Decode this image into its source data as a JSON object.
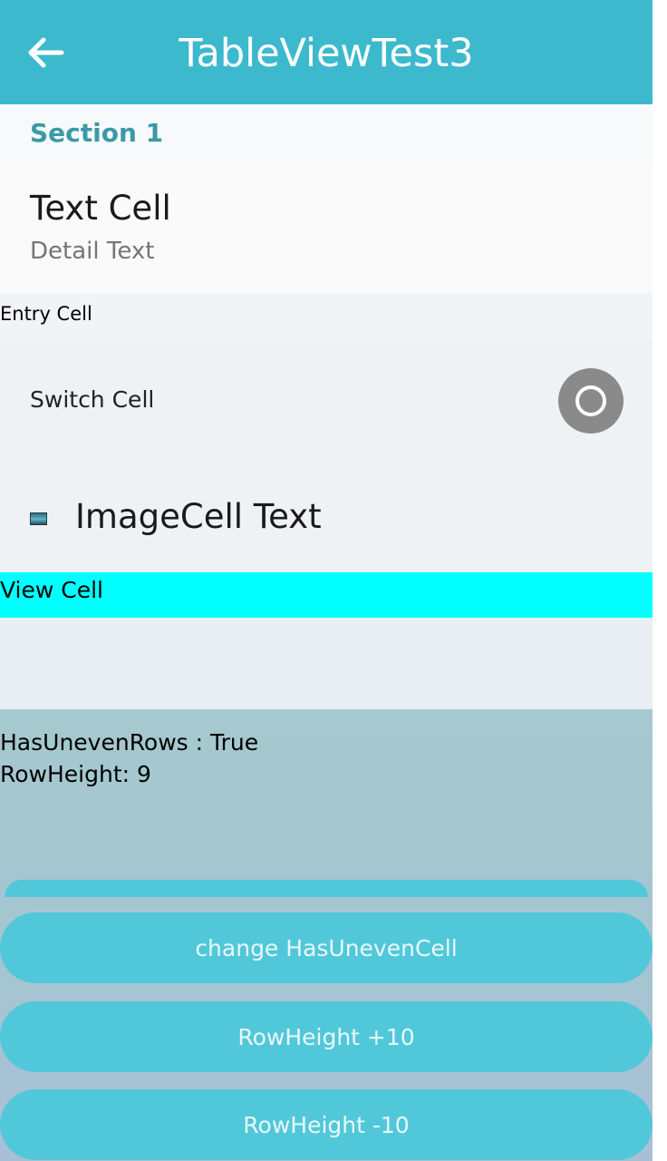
{
  "app_bar": {
    "title": "TableViewTest3",
    "back_icon": "arrow-left-icon",
    "color": "#3db9cd"
  },
  "table": {
    "section_title": "Section 1",
    "text_cell": {
      "text": "Text Cell",
      "detail": "Detail Text"
    },
    "entry_cell": {
      "label": "Entry Cell"
    },
    "switch_cell": {
      "label": "Switch Cell",
      "on": false
    },
    "image_cell": {
      "text": "ImageCell Text",
      "icon": "image-thumbnail-icon"
    },
    "view_cell": {
      "label": "View Cell",
      "color": "#00ffff"
    }
  },
  "status": {
    "has_uneven_rows": "HasUnevenRows : True",
    "row_height": "RowHeight: 9"
  },
  "buttons": {
    "change_uneven": "change HasUnevenCell",
    "row_height_plus": "RowHeight +10",
    "row_height_minus": "RowHeight -10",
    "color": "#51c8da"
  }
}
